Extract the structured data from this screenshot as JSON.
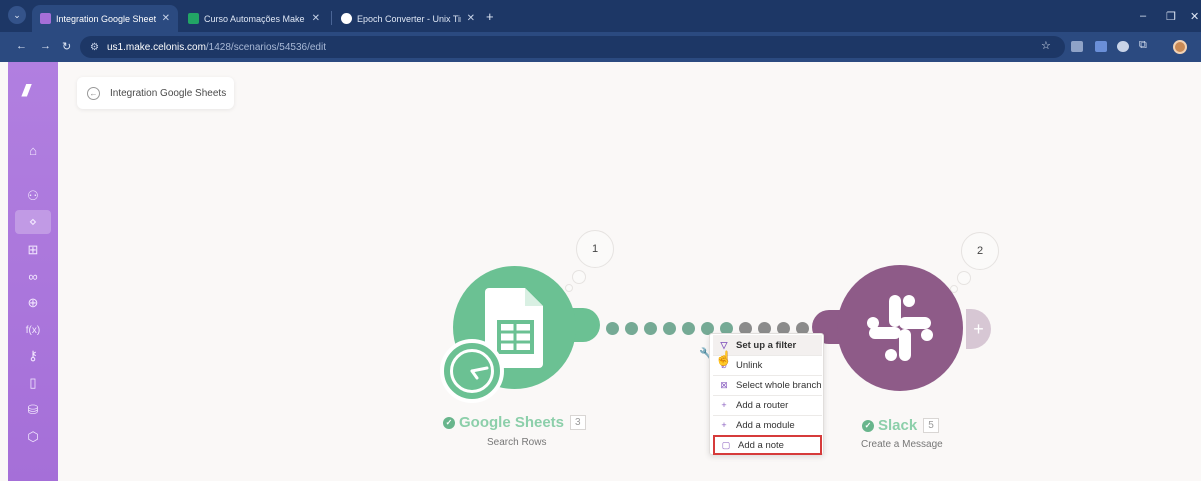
{
  "browser": {
    "tabs": [
      {
        "title": "Integration Google Sheets | Ma",
        "active": true,
        "favicon_color": "#a56fd8"
      },
      {
        "title": "Curso Automações Make - CST",
        "active": false,
        "favicon_color": "#22a565"
      },
      {
        "title": "Epoch Converter - Unix Timesta",
        "active": false,
        "favicon_color": "#ffffff"
      }
    ],
    "url_host": "us1.make.celonis.com",
    "url_path": "/1428/scenarios/54536/edit"
  },
  "scenario": {
    "title": "Integration Google Sheets"
  },
  "modules": [
    {
      "name": "Google Sheets",
      "index": "3",
      "subtitle": "Search Rows",
      "color": "#6bc193",
      "bubble": "1"
    },
    {
      "name": "Slack",
      "index": "5",
      "subtitle": "Create a Message",
      "color": "#8e5b88",
      "bubble": "2"
    }
  ],
  "context_menu": {
    "items": [
      {
        "label": "Set up a filter",
        "icon": "filter-icon"
      },
      {
        "label": "Unlink",
        "icon": "unlink-icon"
      },
      {
        "label": "Select whole branch",
        "icon": "branch-icon"
      },
      {
        "label": "Add a router",
        "icon": "plus-icon"
      },
      {
        "label": "Add a module",
        "icon": "plus-icon"
      },
      {
        "label": "Add a note",
        "icon": "note-icon"
      }
    ]
  },
  "sidebar": {
    "icons": [
      "home-icon",
      "team-icon",
      "scenarios-icon",
      "templates-icon",
      "connections-icon",
      "webhooks-icon",
      "functions-icon",
      "keys-icon",
      "devices-icon",
      "datastores-icon",
      "datastructures-icon"
    ]
  },
  "colors": {
    "brand": "#a56fd8",
    "highlight": "#d63b3b"
  }
}
